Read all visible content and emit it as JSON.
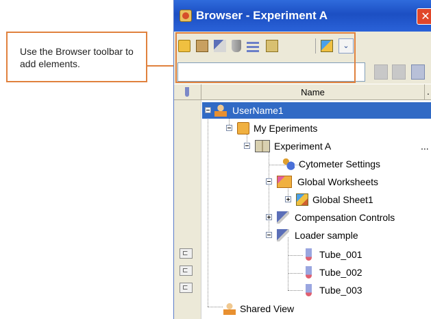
{
  "callout": {
    "text": "Use the Browser toolbar to add elements."
  },
  "window": {
    "title": "Browser - Experiment A",
    "close_glyph": "✕"
  },
  "toolbar": {
    "icons": [
      "new-folder-icon",
      "new-experiment-icon",
      "new-specimen-icon",
      "new-tube-icon",
      "new-sort-layout-icon",
      "new-worksheet-icon",
      "new-global-worksheet-icon"
    ],
    "dropdown_glyph": "⌄"
  },
  "search": {
    "value": "",
    "placeholder": ""
  },
  "table": {
    "column_name": "Name",
    "column_extra": "."
  },
  "tree": {
    "rows": [
      {
        "label": "UserName1",
        "icon": "user-icon",
        "selected": true
      },
      {
        "label": "My Eperiments",
        "icon": "folder-icon"
      },
      {
        "label": "Experiment A",
        "icon": "experiment-book-icon",
        "trailing": "..."
      },
      {
        "label": "Cytometer Settings",
        "icon": "cytometer-settings-icon"
      },
      {
        "label": "Global Worksheets",
        "icon": "global-worksheets-folder-icon"
      },
      {
        "label": "Global Sheet1",
        "icon": "global-sheet-icon"
      },
      {
        "label": "Compensation Controls",
        "icon": "compensation-controls-icon"
      },
      {
        "label": "Loader sample",
        "icon": "specimen-icon"
      },
      {
        "label": "Tube_001",
        "icon": "tube-icon"
      },
      {
        "label": "Tube_002",
        "icon": "tube-icon"
      },
      {
        "label": "Tube_003",
        "icon": "tube-icon"
      },
      {
        "label": "Shared View",
        "icon": "shared-view-icon"
      }
    ]
  },
  "colors": {
    "accent": "#e0813d",
    "title_bar": "#2f6bdc",
    "selection": "#316ac5"
  }
}
